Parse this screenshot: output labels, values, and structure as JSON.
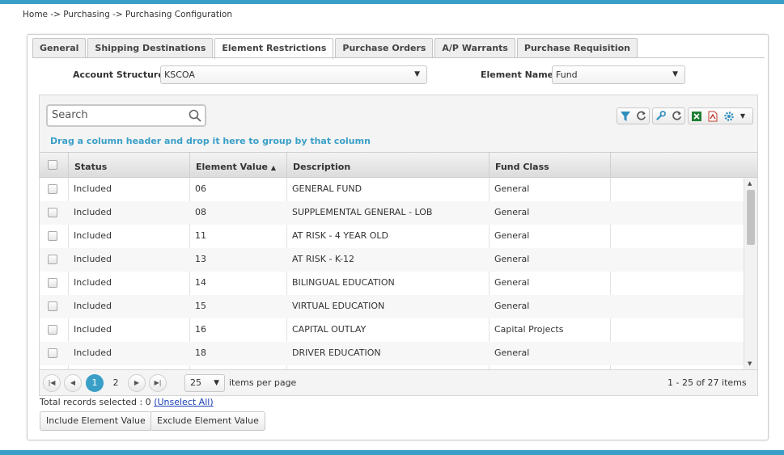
{
  "breadcrumb": "Home -> Purchasing -> Purchasing Configuration",
  "tabs": [
    {
      "label": "General"
    },
    {
      "label": "Shipping Destinations"
    },
    {
      "label": "Element Restrictions"
    },
    {
      "label": "Purchase Orders"
    },
    {
      "label": "A/P Warrants"
    },
    {
      "label": "Purchase Requisition"
    }
  ],
  "filters": {
    "account_structure_label": "Account Structure:",
    "account_structure_value": "KSCOA",
    "element_name_label": "Element Name:",
    "element_name_value": "Fund"
  },
  "grid": {
    "search_placeholder": "Search",
    "drag_hint": "Drag a column header and drop it here to group by that column",
    "columns": {
      "status": "Status",
      "element_value": "Element Value",
      "description": "Description",
      "fund_class": "Fund Class"
    },
    "sort_indicator": "▲",
    "rows": [
      {
        "status": "Included",
        "element_value": "06",
        "description": "GENERAL FUND",
        "fund_class": "General"
      },
      {
        "status": "Included",
        "element_value": "08",
        "description": "SUPPLEMENTAL GENERAL - LOB",
        "fund_class": "General"
      },
      {
        "status": "Included",
        "element_value": "11",
        "description": "AT RISK - 4 YEAR OLD",
        "fund_class": "General"
      },
      {
        "status": "Included",
        "element_value": "13",
        "description": "AT RISK - K-12",
        "fund_class": "General"
      },
      {
        "status": "Included",
        "element_value": "14",
        "description": "BILINGUAL EDUCATION",
        "fund_class": "General"
      },
      {
        "status": "Included",
        "element_value": "15",
        "description": "VIRTUAL EDUCATION",
        "fund_class": "General"
      },
      {
        "status": "Included",
        "element_value": "16",
        "description": "CAPITAL OUTLAY",
        "fund_class": "Capital Projects"
      },
      {
        "status": "Included",
        "element_value": "18",
        "description": "DRIVER EDUCATION",
        "fund_class": "General"
      }
    ]
  },
  "pager": {
    "pages": [
      "1",
      "2"
    ],
    "current_page": "1",
    "page_size": "25",
    "items_per_page_label": "items per page",
    "summary": "1 - 25 of 27 items"
  },
  "selection": {
    "total_text": "Total records selected : 0",
    "unselect_all": "(Unselect All)"
  },
  "actions": {
    "include": "Include Element Value",
    "exclude": "Exclude Element Value"
  },
  "colors": {
    "accent": "#3a9fc7",
    "link": "#1a3fb5",
    "excel_green": "#1e7e34",
    "pdf_red": "#c0392b"
  },
  "icons": [
    "search-icon",
    "filter-icon",
    "refresh-icon",
    "wrench-icon",
    "excel-icon",
    "pdf-icon",
    "gear-icon"
  ]
}
